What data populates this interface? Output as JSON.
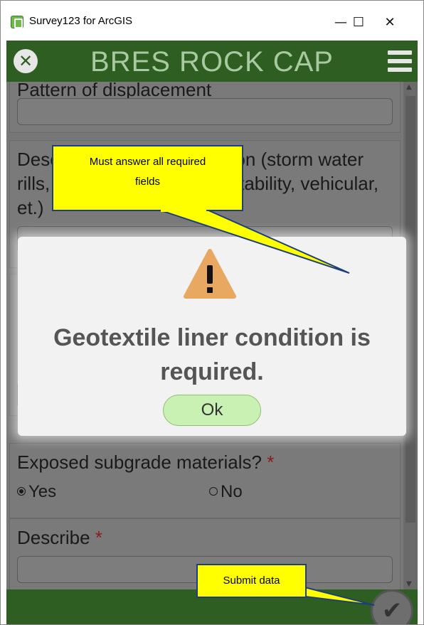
{
  "window": {
    "title": "Survey123 for ArcGIS",
    "minimize_glyph": "—",
    "maximize_glyph": "☐",
    "close_glyph": "✕"
  },
  "header": {
    "title": "BRES ROCK CAP",
    "close_glyph": "✕",
    "menu_icon": "hamburger-icon",
    "background_color": "#2f5e22"
  },
  "form": {
    "questions": [
      {
        "label": "Pattern of displacement"
      },
      {
        "label_line1": "Describe evidence of erosion (storm water",
        "label_line2": "rills, burrowing animals, instability, vehicular,",
        "label_line3": "et.)"
      },
      {
        "label": "Exposed subgrade materials?",
        "required_mark": "*",
        "options": [
          "Yes",
          "No"
        ],
        "selected": "Yes"
      },
      {
        "label": "Describe",
        "required_mark": "*"
      }
    ]
  },
  "dialog": {
    "message_line1": "Geotextile liner condition is",
    "message_line2": "required.",
    "ok_label": "Ok",
    "icon": "warning-icon",
    "warning_color": "#e8a862",
    "ok_color": "#c9f1b3"
  },
  "callouts": {
    "required_note_line1": "Must answer all required",
    "required_note_line2": "fields",
    "submit_note": "Submit data",
    "color": "#ffff00"
  },
  "footer": {
    "submit_icon": "checkmark-icon"
  }
}
